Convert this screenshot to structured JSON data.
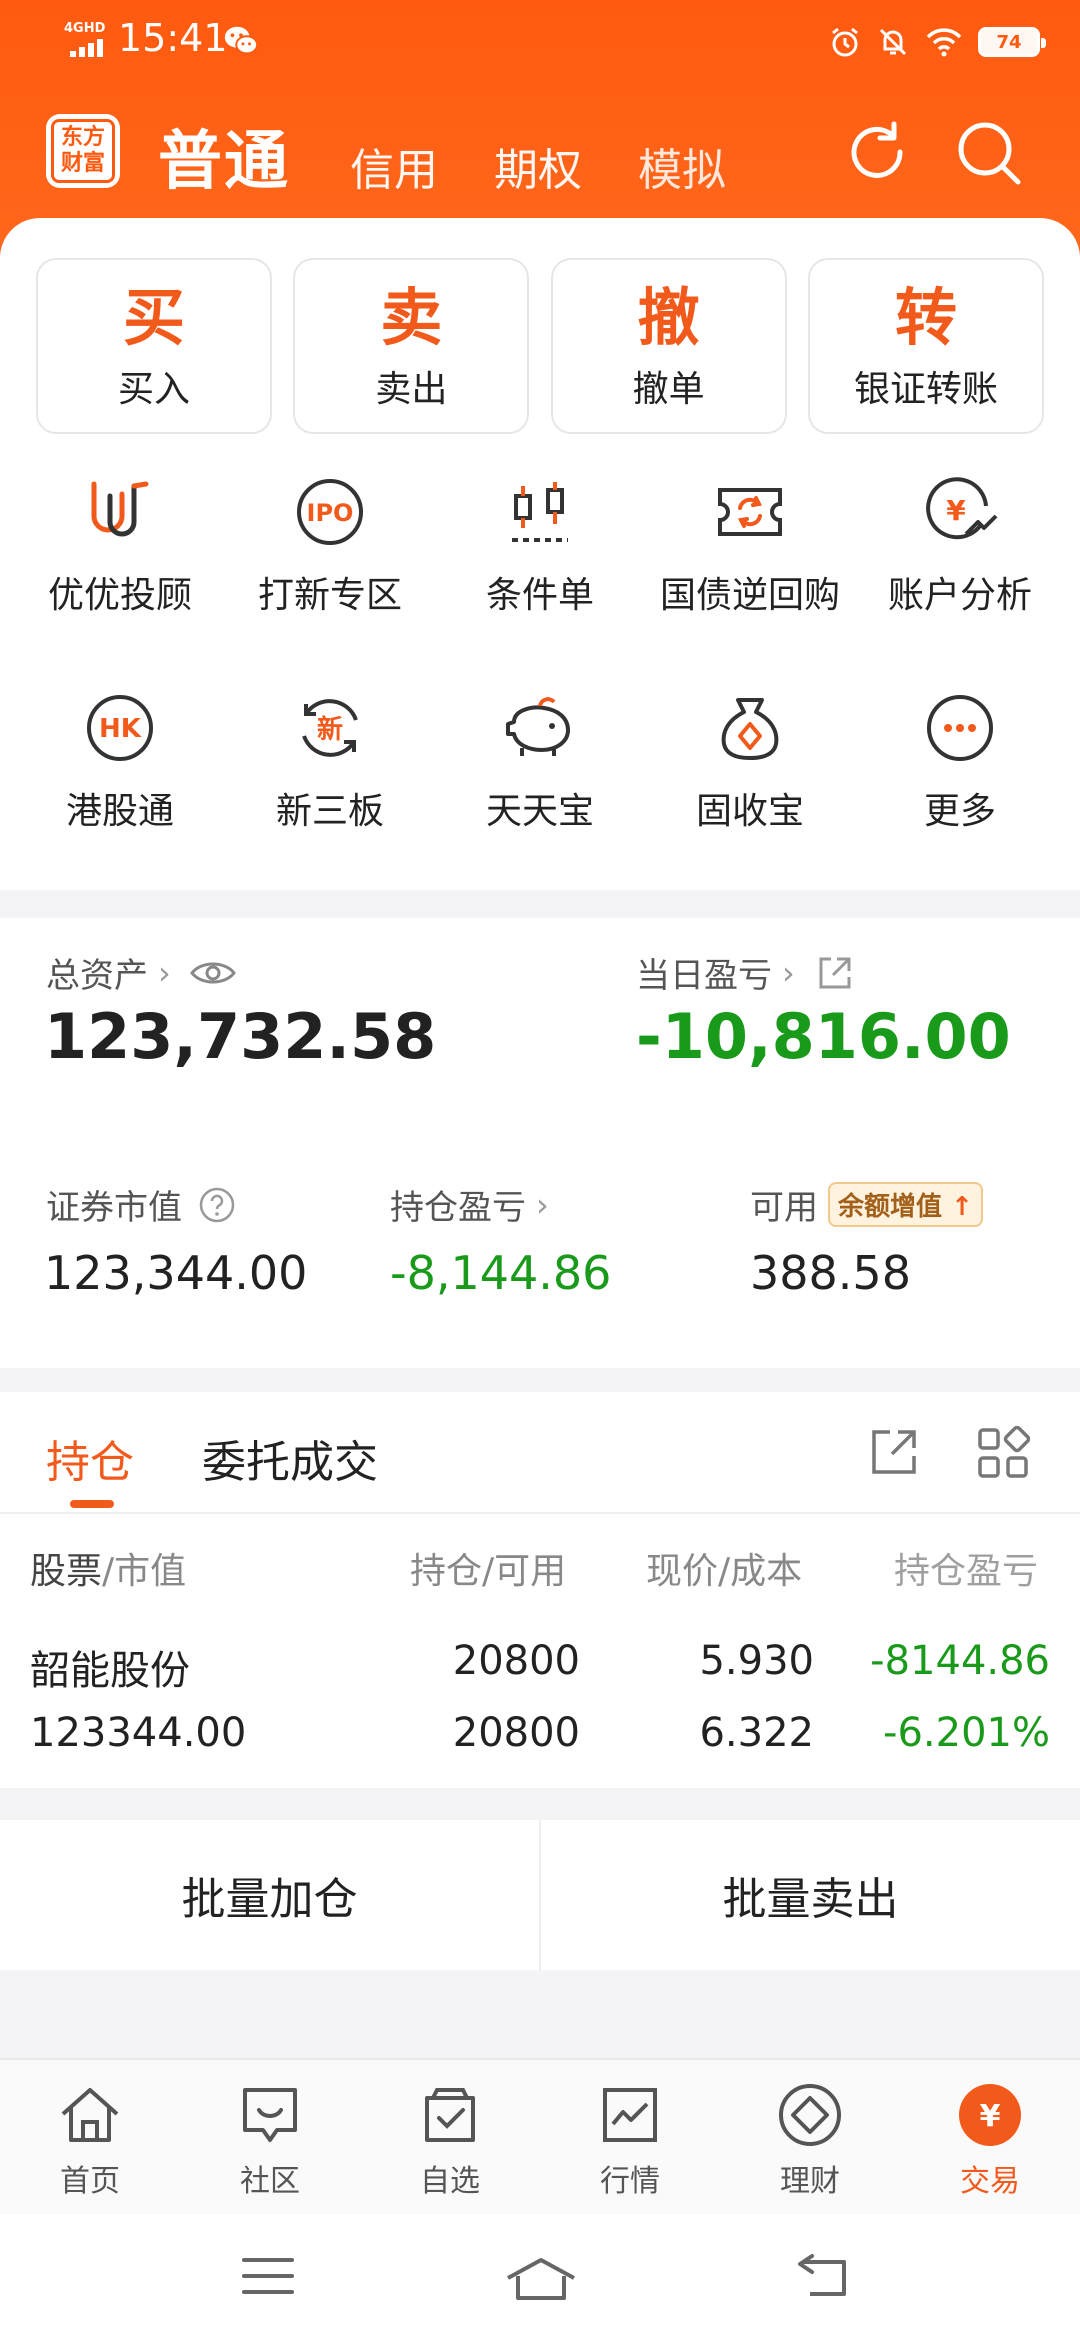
{
  "statusbar": {
    "network": "4GHD",
    "time": "15:41",
    "battery": "74"
  },
  "topnav": {
    "logo_line1": "东方",
    "logo_line2": "财富",
    "tabs": [
      "普通",
      "信用",
      "期权",
      "模拟"
    ]
  },
  "quick_actions": [
    {
      "glyph": "买",
      "label": "买入"
    },
    {
      "glyph": "卖",
      "label": "卖出"
    },
    {
      "glyph": "撤",
      "label": "撤单"
    },
    {
      "glyph": "转",
      "label": "银证转账"
    }
  ],
  "features_row1": [
    {
      "label": "优优投顾",
      "icon": "youyou-icon"
    },
    {
      "label": "打新专区",
      "icon": "ipo-icon",
      "icon_text": "IPO"
    },
    {
      "label": "条件单",
      "icon": "candlestick-icon"
    },
    {
      "label": "国债逆回购",
      "icon": "repo-ticket-icon"
    },
    {
      "label": "账户分析",
      "icon": "yen-chart-icon",
      "icon_text": "¥"
    }
  ],
  "features_row2": [
    {
      "label": "港股通",
      "icon": "hk-icon",
      "icon_text": "HK"
    },
    {
      "label": "新三板",
      "icon": "new-board-icon",
      "icon_text": "新"
    },
    {
      "label": "天天宝",
      "icon": "piggy-bank-icon"
    },
    {
      "label": "固收宝",
      "icon": "money-bag-icon"
    },
    {
      "label": "更多",
      "icon": "more-icon"
    }
  ],
  "assets": {
    "total_label": "总资产",
    "total_value": "123,732.58",
    "daily_pl_label": "当日盈亏",
    "daily_pl_value": "-10,816.00",
    "market_value_label": "证券市值",
    "market_value": "123,344.00",
    "position_pl_label": "持仓盈亏",
    "position_pl": "-8,144.86",
    "available_label": "可用",
    "available_badge": "余额增值",
    "available_value": "388.58"
  },
  "holdings": {
    "tabs": [
      "持仓",
      "委托成交"
    ],
    "columns": {
      "stock_a": "股票",
      "stock_b": "/市值",
      "position": "持仓/可用",
      "price": "现价/成本",
      "pl": "持仓盈亏"
    },
    "rows": [
      {
        "name": "韶能股份",
        "market_value": "123344.00",
        "position": "20800",
        "available": "20800",
        "price": "5.930",
        "cost": "6.322",
        "pl": "-8144.86",
        "pl_pct": "-6.201%"
      }
    ]
  },
  "batch": {
    "add": "批量加仓",
    "sell": "批量卖出"
  },
  "bottom_nav": [
    {
      "label": "首页",
      "icon": "home-icon"
    },
    {
      "label": "社区",
      "icon": "community-icon"
    },
    {
      "label": "自选",
      "icon": "watchlist-icon"
    },
    {
      "label": "行情",
      "icon": "market-icon"
    },
    {
      "label": "理财",
      "icon": "wealth-icon"
    },
    {
      "label": "交易",
      "icon": "trade-icon",
      "icon_text": "¥",
      "active": true
    }
  ],
  "colors": {
    "accent": "#f25a1c",
    "header": "#ff5a10",
    "loss_green": "#1a9a1a"
  }
}
